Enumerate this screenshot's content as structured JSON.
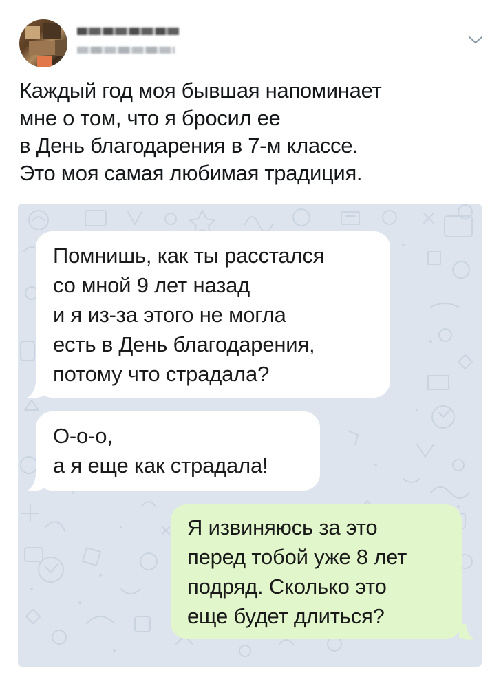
{
  "tweet": {
    "text_lines": [
      "Каждый год моя бывшая напоминает",
      "мне о том, что я бросил ее",
      "в День благодарения в 7-м классе.",
      "Это моя самая любимая традиция."
    ]
  },
  "chat": {
    "messages": [
      {
        "direction": "incoming",
        "lines": [
          "Помнишь, как ты расстался",
          "со мной 9 лет назад",
          "и я из-за этого не могла",
          "есть в День благодарения,",
          "потому что страдала?"
        ]
      },
      {
        "direction": "incoming",
        "lines": [
          "О-о-о,",
          "а я еще как страдала!"
        ]
      },
      {
        "direction": "outgoing",
        "lines": [
          "Я извиняюсь за это",
          "перед тобой уже 8 лет",
          "подряд. Сколько это",
          "еще будет длиться?"
        ]
      }
    ]
  },
  "colors": {
    "text": "#14171a",
    "chat_background": "#dde4ed",
    "incoming_bubble": "#ffffff",
    "outgoing_bubble": "#e1f7cb",
    "chevron": "#8899a6"
  },
  "icons": {
    "menu": "chevron-down-icon"
  }
}
